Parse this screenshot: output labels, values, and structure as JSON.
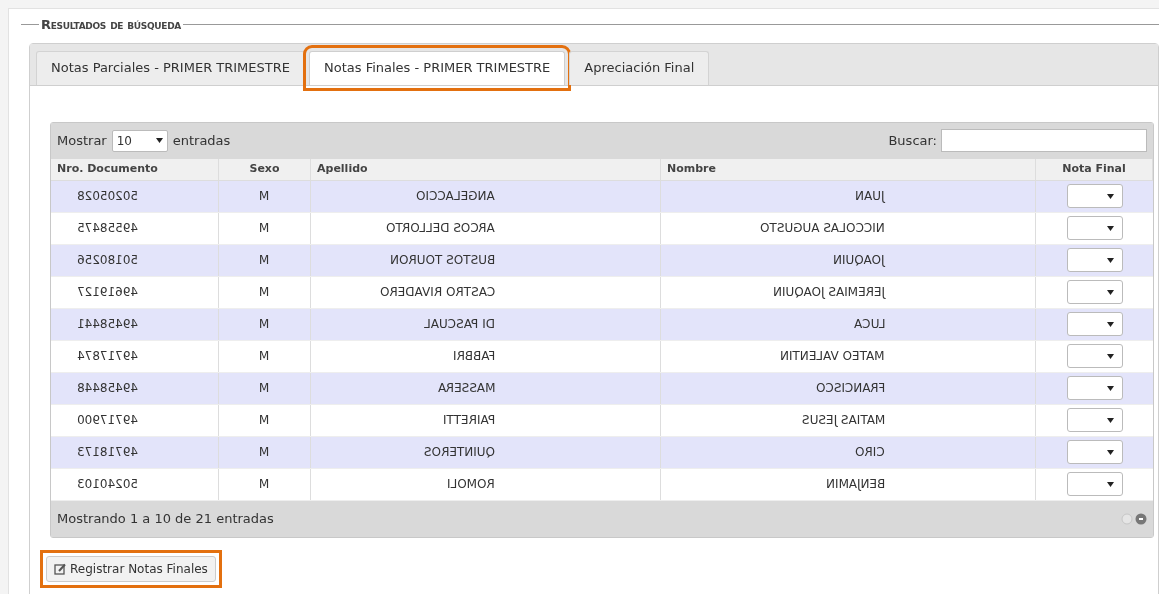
{
  "section_title": "Resultados de búsqueda",
  "tabs": [
    {
      "label": "Notas Parciales - PRIMER TRIMESTRE",
      "selected": false,
      "highlighted": false
    },
    {
      "label": "Notas Finales - PRIMER TRIMESTRE",
      "selected": true,
      "highlighted": true
    },
    {
      "label": "Apreciación Final",
      "selected": false,
      "highlighted": false
    }
  ],
  "length_control": {
    "prefix": "Mostrar",
    "value": "10",
    "suffix": "entradas"
  },
  "search": {
    "label": "Buscar:"
  },
  "table": {
    "mirrored_cells": true,
    "columns": [
      "Nro. Documento",
      "Sexo",
      "Apellido",
      "Nombre",
      "Nota Final"
    ],
    "rows": [
      {
        "documento": "50205028",
        "sexo": "M",
        "apellido": "ANGELACCIO",
        "nombre": "JUAN"
      },
      {
        "documento": "49558475",
        "sexo": "M",
        "apellido": "ARCOS DELLORTO",
        "nombre": "NICCOLAS AUGUSTO"
      },
      {
        "documento": "50180256",
        "sexo": "M",
        "apellido": "BUSTOS TOURON",
        "nombre": "JOAQUIN"
      },
      {
        "documento": "49619127",
        "sexo": "M",
        "apellido": "CASTRO RIVADERO",
        "nombre": "JEREMIAS JOAQUIN"
      },
      {
        "documento": "49458441",
        "sexo": "M",
        "apellido": "DI PASCUAL",
        "nombre": "LUCA"
      },
      {
        "documento": "49717874",
        "sexo": "M",
        "apellido": "FABBRI",
        "nombre": "MATEO VALENTIN"
      },
      {
        "documento": "49458448",
        "sexo": "M",
        "apellido": "MASSERA",
        "nombre": "FRANCISCO"
      },
      {
        "documento": "49717900",
        "sexo": "M",
        "apellido": "PAIRETTI",
        "nombre": "MATIAS JESUS"
      },
      {
        "documento": "49718173",
        "sexo": "M",
        "apellido": "QUINTEROS",
        "nombre": "CIRO"
      },
      {
        "documento": "50240103",
        "sexo": "M",
        "apellido": "ROMOLI",
        "nombre": "BENJAMIN"
      }
    ]
  },
  "info": "Mostrando 1 a 10 de 21 entradas",
  "button": {
    "label": "Registrar Notas Finales",
    "highlighted": true
  }
}
